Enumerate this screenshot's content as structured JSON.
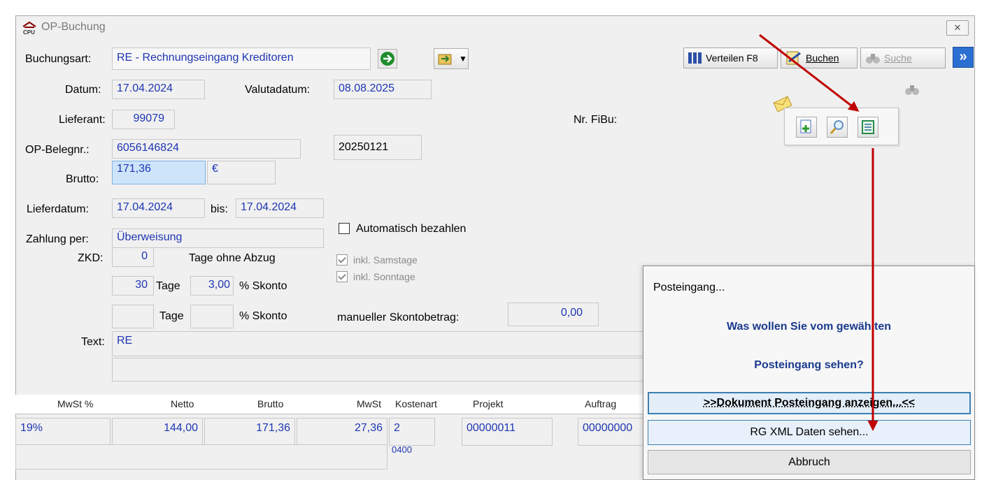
{
  "window": {
    "title": "OP-Buchung",
    "close": "✕"
  },
  "toolbar": {
    "buchungsart_label": "Buchungsart:",
    "buchungsart_value": "RE - Rechnungseingang Kreditoren",
    "verteilen": "Verteilen F8",
    "buchen": "Buchen",
    "suche": "Suche",
    "more": "»"
  },
  "form": {
    "datum_label": "Datum:",
    "datum": "17.04.2024",
    "valuta_label": "Valutadatum:",
    "valuta": "08.08.2025",
    "lieferant_label": "Lieferant:",
    "lieferant": "99079",
    "nrfibu_label": "Nr. FiBu:",
    "belegnr_label": "OP-Belegnr.:",
    "belegnr": "6056146824",
    "belegnr2": "20250121",
    "brutto_label": "Brutto:",
    "brutto": "171,36",
    "currency": "€",
    "lieferdatum_label": "Lieferdatum:",
    "lieferdatum": "17.04.2024",
    "bis_label": "bis:",
    "bis": "17.04.2024",
    "zahlung_label": "Zahlung per:",
    "zahlung": "Überweisung",
    "auto_label": "Automatisch bezahlen",
    "zkd_label": "ZKD:",
    "zkd": "0",
    "tage_ohne": "Tage ohne Abzug",
    "samstage": "inkl. Samstage",
    "sonntage": "inkl. Sonntage",
    "tage1": "30",
    "tage_label": "Tage",
    "skonto1": "3,00",
    "skonto_label": "% Skonto",
    "manuell_label": "manueller Skontobetrag:",
    "manuell": "0,00",
    "text_label": "Text:",
    "text": "RE"
  },
  "grid": {
    "headers": [
      "MwSt %",
      "Netto",
      "Brutto",
      "MwSt",
      "Kostenart",
      "Projekt",
      "Auftrag"
    ],
    "row": {
      "mwst_pct": "19%",
      "netto": "144,00",
      "brutto": "171,36",
      "mwst": "27,36",
      "kostenart": "2",
      "kostenart_sub": "0400",
      "projekt": "00000011",
      "auftrag": "00000000"
    }
  },
  "dialog": {
    "title": "Posteingang...",
    "question_line1": "Was wollen Sie vom gewählten",
    "question_line2": "Posteingang sehen?",
    "btn_doc": ">>Dokument Posteingang anzeigen...<<",
    "btn_xml": "RG XML Daten sehen...",
    "btn_cancel": "Abbruch"
  },
  "colors": {
    "value_text": "#1d36b3",
    "arrow": "#c00000",
    "focus": "#3c7fb1"
  }
}
